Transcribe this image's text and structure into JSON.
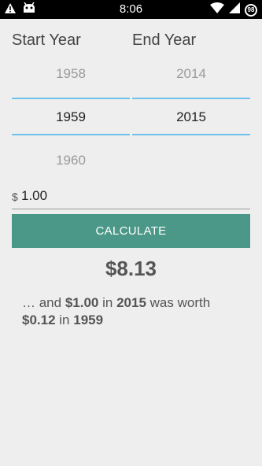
{
  "status_bar": {
    "time": "8:06",
    "battery": "98",
    "left_icons": [
      "warning-icon",
      "android-icon"
    ],
    "right_icons": [
      "wifi-icon",
      "signal-icon",
      "battery-icon"
    ]
  },
  "start_year": {
    "label": "Start Year",
    "prev": "1958",
    "selected": "1959",
    "next": "1960"
  },
  "end_year": {
    "label": "End Year",
    "prev": "2014",
    "selected": "2015",
    "next": null
  },
  "amount": {
    "currency_symbol": "$",
    "value": "1.00"
  },
  "calculate_button": {
    "label": "CALCULATE"
  },
  "result": {
    "value": "$8.13",
    "explanation": {
      "prefix": "… and",
      "amount": "$1.00",
      "in1": "in",
      "end_year": "2015",
      "was_worth": "was worth",
      "worth_value": "$0.12",
      "in2": "in",
      "start_year": "1959"
    }
  },
  "colors": {
    "accent_line": "#6ec1ea",
    "button": "#4b9888",
    "background": "#eeeeee"
  }
}
